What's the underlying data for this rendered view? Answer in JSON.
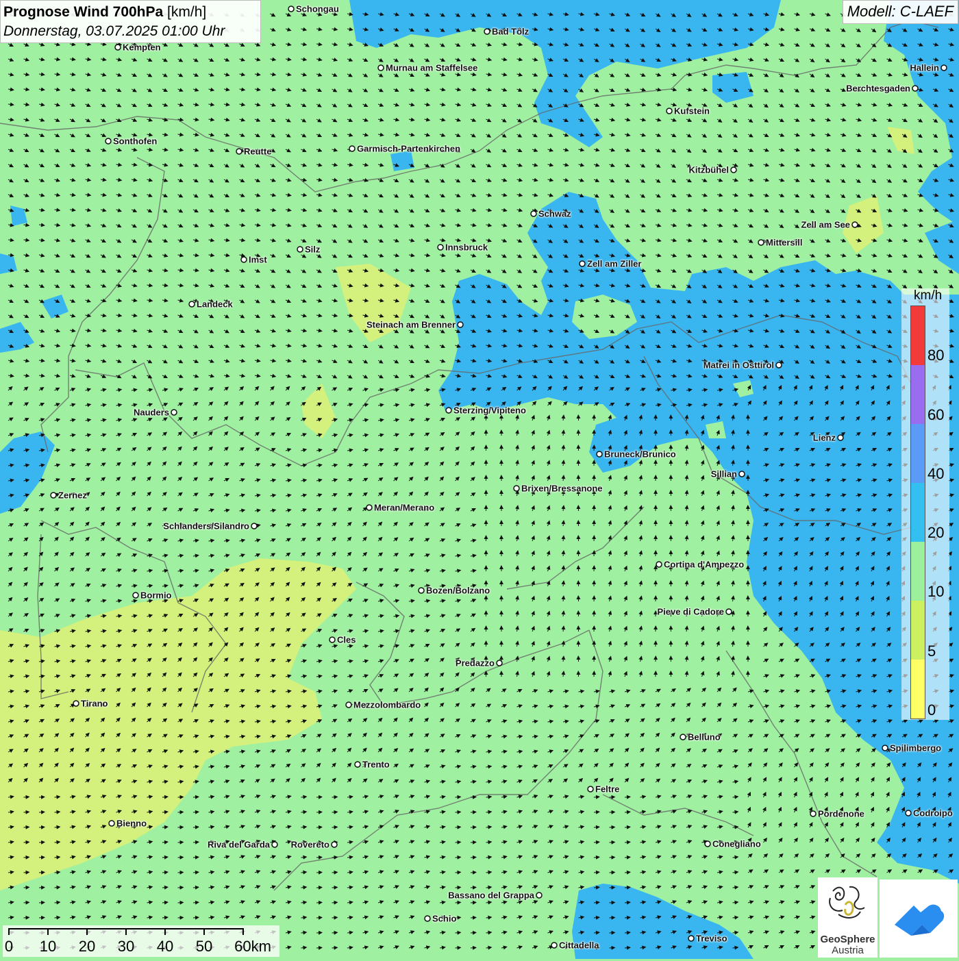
{
  "header": {
    "title_bold": "Prognose Wind 700hPa",
    "title_unit": "[km/h]",
    "datetime": "Donnerstag, 03.07.2025 01:00 Uhr",
    "model": "Modell: C-LAEF"
  },
  "legend": {
    "unit": "km/h",
    "ticks": [
      "80",
      "60",
      "40",
      "20",
      "10",
      "5",
      "0"
    ],
    "colors": [
      "#f23a3a",
      "#9a6cf0",
      "#5a9cf5",
      "#33bff0",
      "#9cf09c",
      "#ccf060",
      "#ffff66"
    ]
  },
  "map_colors": {
    "calm_green": "#9ff0a0",
    "light_yellow": "#d8f07a",
    "blue": "#39b6f0",
    "boundary": "#666666"
  },
  "scalebar": {
    "labels": [
      "0",
      "10",
      "20",
      "30",
      "40",
      "50",
      "60km"
    ]
  },
  "cities": [
    {
      "name": "Schongau"
    },
    {
      "name": "Kempten"
    },
    {
      "name": "Bad Tölz"
    },
    {
      "name": "Murnau am Staffelsee"
    },
    {
      "name": "Hallein"
    },
    {
      "name": "Berchtesgaden"
    },
    {
      "name": "Kufstein"
    },
    {
      "name": "Sonthofen"
    },
    {
      "name": "Reutte"
    },
    {
      "name": "Garmisch-Partenkirchen"
    },
    {
      "name": "Kitzbühel"
    },
    {
      "name": "Schwaz"
    },
    {
      "name": "Zell am See"
    },
    {
      "name": "Mittersill"
    },
    {
      "name": "Imst"
    },
    {
      "name": "Silz"
    },
    {
      "name": "Innsbruck"
    },
    {
      "name": "Zell am Ziller"
    },
    {
      "name": "Landeck"
    },
    {
      "name": "Steinach am Brenner"
    },
    {
      "name": "Matrei in Osttirol"
    },
    {
      "name": "Nauders"
    },
    {
      "name": "Sterzing/Vipiteno"
    },
    {
      "name": "Lienz"
    },
    {
      "name": "Bruneck/Brunico"
    },
    {
      "name": "Sillian"
    },
    {
      "name": "Zernez"
    },
    {
      "name": "Brixen/Bressanone"
    },
    {
      "name": "Meran/Merano"
    },
    {
      "name": "Schlanders/Silandro"
    },
    {
      "name": "Cortina d'Ampezzo"
    },
    {
      "name": "Bormio"
    },
    {
      "name": "Bozen/Bolzano"
    },
    {
      "name": "Pieve di Cadore"
    },
    {
      "name": "Cles"
    },
    {
      "name": "Predazzo"
    },
    {
      "name": "Tirano"
    },
    {
      "name": "Mezzolombardo"
    },
    {
      "name": "Belluno"
    },
    {
      "name": "Spilimbergo"
    },
    {
      "name": "Trento"
    },
    {
      "name": "Feltre"
    },
    {
      "name": "Bienno"
    },
    {
      "name": "Pordenone"
    },
    {
      "name": "Codroipo"
    },
    {
      "name": "Riva del Garda"
    },
    {
      "name": "Rovereto"
    },
    {
      "name": "Conegliano"
    },
    {
      "name": "Bassano del Grappa"
    },
    {
      "name": "Schio"
    },
    {
      "name": "Treviso"
    },
    {
      "name": "Cittadella"
    }
  ],
  "logos": {
    "geosphere_line1": "GeoSphere",
    "geosphere_line2": "Austria"
  }
}
